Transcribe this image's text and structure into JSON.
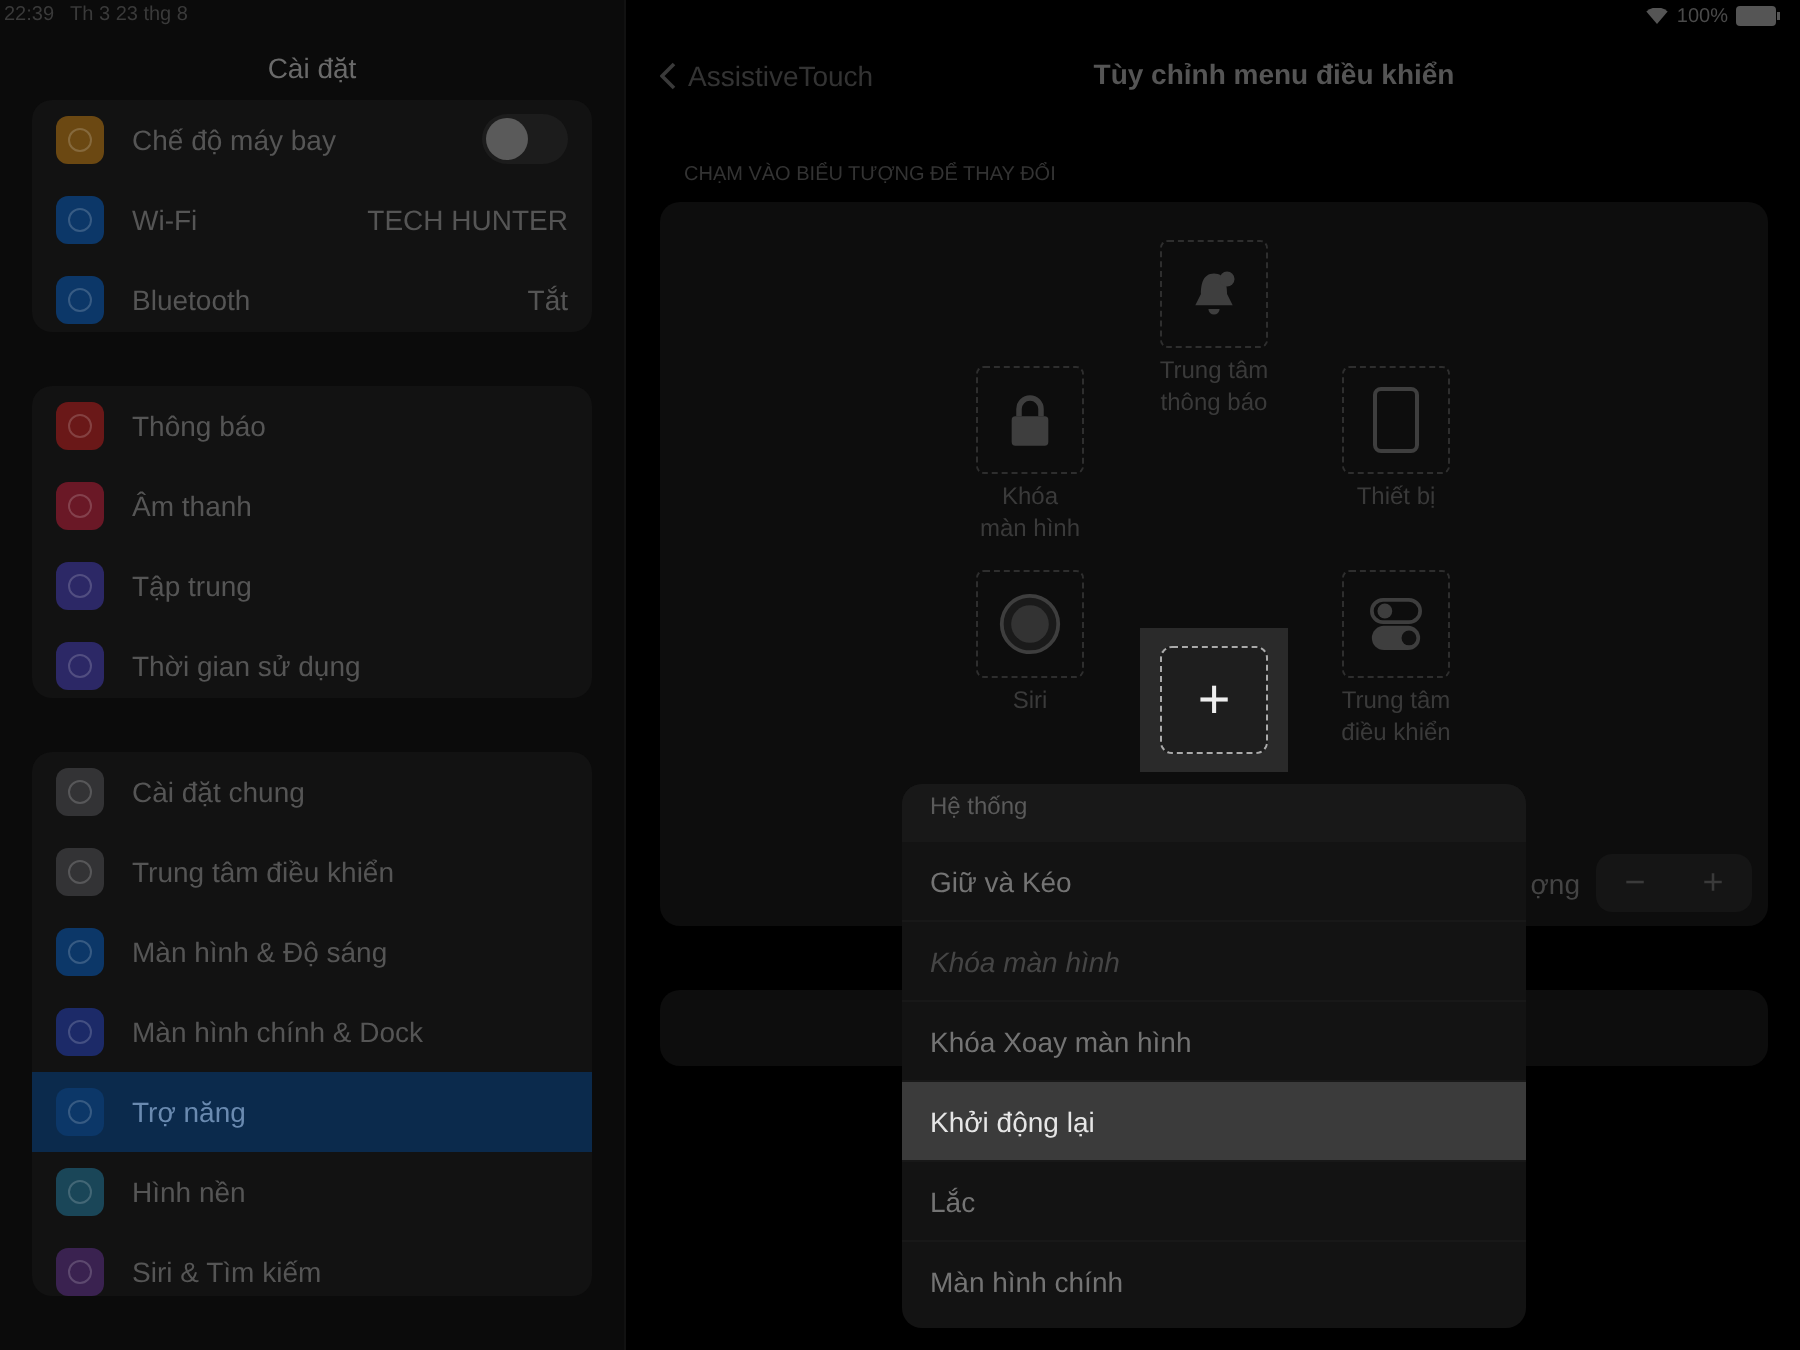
{
  "status_bar": {
    "time": "22:39",
    "date": "Th 3 23 thg 8",
    "battery": "100%"
  },
  "sidebar": {
    "title": "Cài đặt",
    "groups": [
      [
        {
          "label": "Chế độ máy bay",
          "kind": "toggle",
          "on": false,
          "color": "#6b4812",
          "selected": false
        },
        {
          "label": "Wi-Fi",
          "kind": "value",
          "value": "TECH HUNTER",
          "color": "#0c3768",
          "selected": false
        },
        {
          "label": "Bluetooth",
          "kind": "value",
          "value": "Tắt",
          "color": "#0c3768",
          "selected": false
        }
      ],
      [
        {
          "label": "Thông báo",
          "kind": "link",
          "color": "#6a1818",
          "selected": false
        },
        {
          "label": "Âm thanh",
          "kind": "link",
          "color": "#6a1826",
          "selected": false
        },
        {
          "label": "Tập trung",
          "kind": "link",
          "color": "#2c2866",
          "selected": false
        },
        {
          "label": "Thời gian sử dụng",
          "kind": "link",
          "color": "#2c2866",
          "selected": false
        }
      ],
      [
        {
          "label": "Cài đặt chung",
          "kind": "link",
          "color": "#333335",
          "selected": false
        },
        {
          "label": "Trung tâm điều khiển",
          "kind": "link",
          "color": "#333335",
          "selected": false
        },
        {
          "label": "Màn hình & Độ sáng",
          "kind": "link",
          "color": "#0c3768",
          "selected": false
        },
        {
          "label": "Màn hình chính & Dock",
          "kind": "link",
          "color": "#1c2a68",
          "selected": false
        },
        {
          "label": "Trợ năng",
          "kind": "link",
          "color": "#0c3768",
          "selected": true
        },
        {
          "label": "Hình nền",
          "kind": "link",
          "color": "#1a4658",
          "selected": false
        },
        {
          "label": "Siri & Tìm kiếm",
          "kind": "link",
          "color": "#3a2250",
          "selected": false
        }
      ]
    ]
  },
  "nav": {
    "back": "AssistiveTouch",
    "title": "Tùy chỉnh menu điều khiển"
  },
  "section_header": "CHẠM VÀO BIỂU TƯỢNG ĐỂ THAY ĐỔI",
  "menu_slots": [
    {
      "label": "Trung tâm\nthông báo",
      "kind": "bell"
    },
    {
      "label": "Khóa\nmàn hình",
      "kind": "lock"
    },
    {
      "label": "Thiết bị",
      "kind": "device"
    },
    {
      "label": "Siri",
      "kind": "siri"
    },
    {
      "label": "Trung tâm\nđiều khiển",
      "kind": "switches"
    }
  ],
  "add_slot": "+",
  "count_row": {
    "label": "ợng",
    "minus": "−",
    "plus": "+"
  },
  "popup": {
    "header": "Hệ thống",
    "items": [
      {
        "label": "Giữ và Kéo",
        "disabled": false,
        "selected": false
      },
      {
        "label": "Khóa màn hình",
        "disabled": true,
        "selected": false
      },
      {
        "label": "Khóa Xoay màn hình",
        "disabled": false,
        "selected": false
      },
      {
        "label": "Khởi động lại",
        "disabled": false,
        "selected": true
      },
      {
        "label": "Lắc",
        "disabled": false,
        "selected": false
      },
      {
        "label": "Màn hình chính",
        "disabled": false,
        "selected": false
      }
    ]
  }
}
